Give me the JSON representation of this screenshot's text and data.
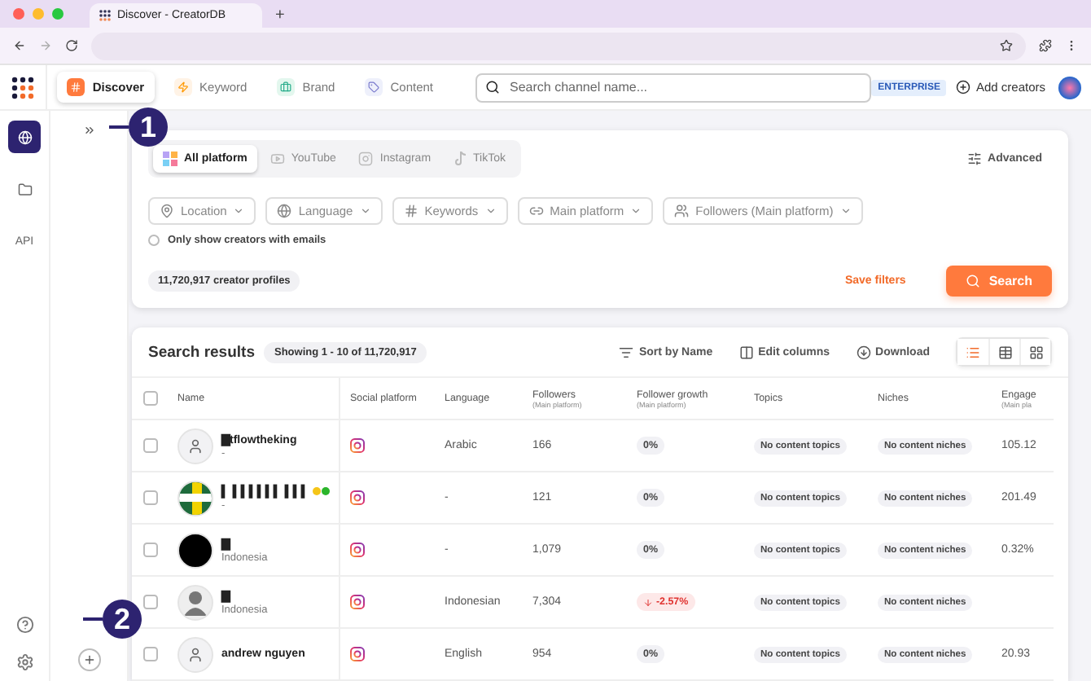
{
  "browser": {
    "tab_title": "Discover - CreatorDB",
    "new_tab": "+"
  },
  "nav": {
    "items": [
      {
        "label": "Discover",
        "kind": "discover",
        "selected": true
      },
      {
        "label": "Keyword",
        "kind": "keyword",
        "selected": false
      },
      {
        "label": "Brand",
        "kind": "brand",
        "selected": false
      },
      {
        "label": "Content",
        "kind": "content",
        "selected": false
      }
    ],
    "search_placeholder": "Search channel name...",
    "plan_badge": "ENTERPRISE",
    "add_creators": "Add creators"
  },
  "sidebar": {
    "items": [
      {
        "kind": "globe",
        "selected": true
      },
      {
        "kind": "folder",
        "selected": false
      },
      {
        "kind": "text",
        "label": "API",
        "selected": false
      }
    ]
  },
  "platform_tabs": [
    {
      "label": "All platform",
      "kind": "all",
      "selected": true
    },
    {
      "label": "YouTube",
      "kind": "youtube",
      "selected": false
    },
    {
      "label": "Instagram",
      "kind": "instagram",
      "selected": false
    },
    {
      "label": "TikTok",
      "kind": "tiktok",
      "selected": false
    }
  ],
  "advanced": "Advanced",
  "filters": [
    {
      "label": "Location",
      "kind": "pin"
    },
    {
      "label": "Language",
      "kind": "globe"
    },
    {
      "label": "Keywords",
      "kind": "hash"
    },
    {
      "label": "Main platform",
      "kind": "link"
    },
    {
      "label": "Followers (Main platform)",
      "kind": "people"
    }
  ],
  "email_filter": {
    "label": "Only show creators with emails",
    "checked": false
  },
  "profile_count": "11,720,917 creator profiles",
  "save_filters": "Save filters",
  "search_button": "Search",
  "results": {
    "title": "Search results",
    "showing": "Showing 1 - 10 of 11,720,917",
    "select_all_checked": false,
    "actions": [
      {
        "label": "Sort by Name",
        "kind": "sort"
      },
      {
        "label": "Edit columns",
        "kind": "columns"
      },
      {
        "label": "Download",
        "kind": "download"
      }
    ],
    "view_modes": [
      {
        "kind": "list",
        "selected": true
      },
      {
        "kind": "table",
        "selected": false
      },
      {
        "kind": "grid",
        "selected": false
      }
    ],
    "columns": [
      {
        "label": "Name"
      },
      {
        "label": "Social platform"
      },
      {
        "label": "Language"
      },
      {
        "label": "Followers",
        "sublabel": "(Main platform)"
      },
      {
        "label": "Follower growth",
        "sublabel": "(Main platform)"
      },
      {
        "label": "Topics"
      },
      {
        "label": "Niches"
      },
      {
        "label": "Engage",
        "sublabel": "(Main pla"
      }
    ],
    "rows": [
      {
        "checked": false,
        "name": "▇tflowtheking",
        "subtitle": "-",
        "avatar": {
          "kind": "person"
        },
        "language": "Arabic",
        "followers": "166",
        "growth": {
          "value": "0%",
          "kind": "flat"
        },
        "topics": "No content topics",
        "niches": "No content niches",
        "engagement": "105.12"
      },
      {
        "checked": false,
        "name": "▍ ▍▍▍▍▍▍ ▍▍▍",
        "subtitle": "-",
        "avatar": {
          "kind": "logo"
        },
        "language": "-",
        "followers": "121",
        "growth": {
          "value": "0%",
          "kind": "flat"
        },
        "topics": "No content topics",
        "niches": "No content niches",
        "engagement": "201.49"
      },
      {
        "checked": false,
        "name": "▇",
        "subtitle": "Indonesia",
        "avatar": {
          "kind": "dark"
        },
        "language": "-",
        "followers": "1,079",
        "growth": {
          "value": "0%",
          "kind": "flat"
        },
        "topics": "No content topics",
        "niches": "No content niches",
        "engagement": "0.32%"
      },
      {
        "checked": false,
        "name": "▇",
        "subtitle": "Indonesia",
        "avatar": {
          "kind": "silhouette"
        },
        "language": "Indonesian",
        "followers": "7,304",
        "growth": {
          "value": "-2.57%",
          "kind": "down"
        },
        "topics": "No content topics",
        "niches": "No content niches"
      },
      {
        "checked": false,
        "name": "andrew nguyen",
        "avatar": {
          "kind": "person"
        },
        "language": "English",
        "followers": "954",
        "growth": {
          "value": "0%",
          "kind": "flat"
        },
        "topics": "No content topics",
        "niches": "No content niches",
        "engagement": "20.93"
      }
    ]
  },
  "annotations": [
    {
      "label": "1"
    },
    {
      "label": "2"
    }
  ]
}
